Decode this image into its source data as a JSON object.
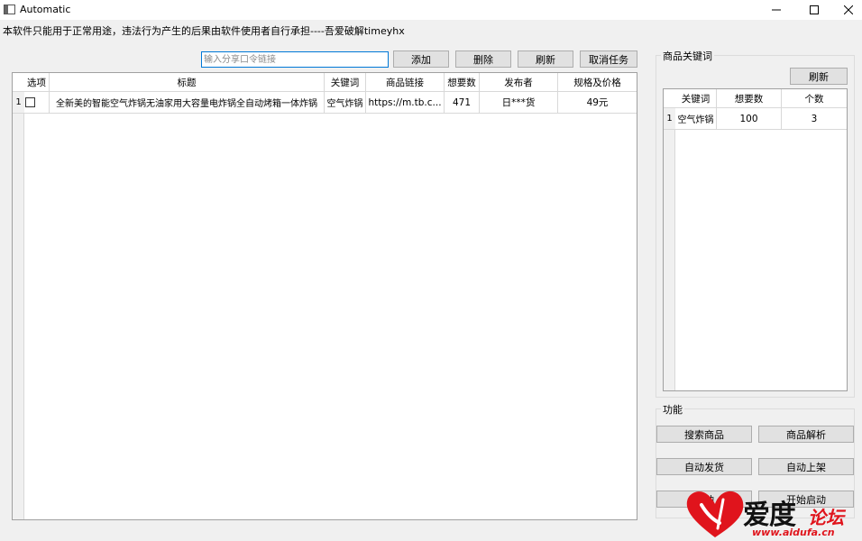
{
  "window": {
    "title": "Automatic"
  },
  "notice": "本软件只能用于正常用途，违法行为产生的后果由软件使用者自行承担----吾爱破解timeyhx",
  "toolbar": {
    "share_placeholder": "输入分享口令链接",
    "add_label": "添加",
    "delete_label": "删除",
    "refresh_label": "刷新",
    "cancel_label": "取消任务"
  },
  "main_table": {
    "headers": [
      "选项",
      "标题",
      "关键词",
      "商品链接",
      "想要数",
      "发布者",
      "规格及价格"
    ],
    "rows": [
      {
        "num": "1",
        "title": "全新美的智能空气炸锅无油家用大容量电炸锅全自动烤箱一体炸锅",
        "keyword": "空气炸锅",
        "link": "https://m.tb.c...",
        "wants": "471",
        "publisher": "日***货",
        "price": "49元"
      }
    ]
  },
  "keyword_panel": {
    "title": "商品关键词",
    "refresh_label": "刷新",
    "headers": [
      "关键词",
      "想要数",
      "个数"
    ],
    "rows": [
      {
        "num": "1",
        "keyword": "空气炸锅",
        "wants": "100",
        "count": "3"
      }
    ]
  },
  "function_panel": {
    "title": "功能",
    "search_label": "搜索商品",
    "parse_label": "商品解析",
    "auto_ship_label": "自动发货",
    "auto_list_label": "自动上架",
    "auto_partial_label": "自动",
    "start_partial_label": "开始启动"
  },
  "watermark": {
    "brand": "爱度",
    "suffix": "论坛",
    "url": "www.aidufa.cn"
  },
  "colors": {
    "accent_border": "#0078d7",
    "watermark_red": "#e0141c"
  }
}
